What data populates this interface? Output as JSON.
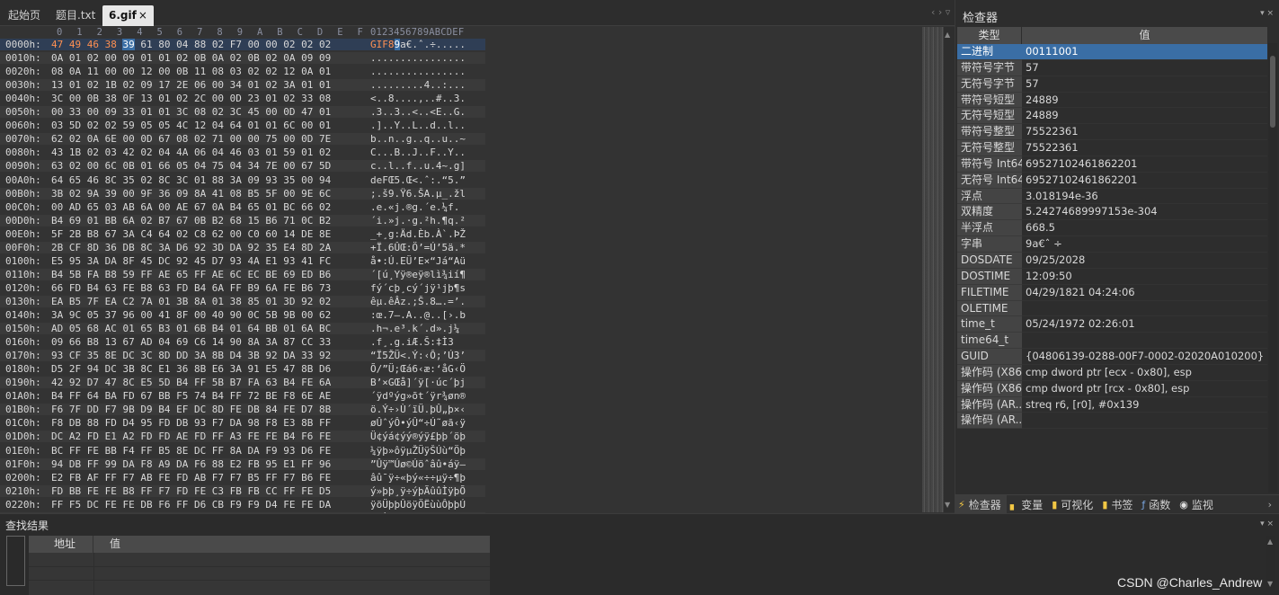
{
  "tabs": [
    {
      "label": "起始页",
      "active": false
    },
    {
      "label": "题目.txt",
      "active": false
    },
    {
      "label": "6.gif",
      "active": true,
      "close": "×"
    }
  ],
  "tab_nav": "‹ › ▿",
  "hex": {
    "column_headers": [
      "0",
      "1",
      "2",
      "3",
      "4",
      "5",
      "6",
      "7",
      "8",
      "9",
      "A",
      "B",
      "C",
      "D",
      "E",
      "F"
    ],
    "ascii_header": "0123456789ABCDEF",
    "rows": [
      {
        "off": "0000h:",
        "hex": "47 49 46 38 39 61 80 04 88 02 F7 00 00 02 02 02",
        "asc": "GIF89a€.ˆ.÷....."
      },
      {
        "off": "0010h:",
        "hex": "0A 01 02 00 09 01 01 02 0B 0A 02 0B 02 0A 09 09",
        "asc": "................"
      },
      {
        "off": "0020h:",
        "hex": "08 0A 11 00 00 12 00 0B 11 08 03 02 02 12 0A 01",
        "asc": "................"
      },
      {
        "off": "0030h:",
        "hex": "13 01 02 1B 02 09 17 2E 06 00 34 01 02 3A 01 01",
        "asc": ".........4..:..."
      },
      {
        "off": "0040h:",
        "hex": "3C 00 0B 38 0F 13 01 02 2C 00 0D 23 01 02 33 08",
        "asc": "<..8....,..#..3."
      },
      {
        "off": "0050h:",
        "hex": "00 33 00 09 33 01 01 3C 08 02 3C 45 00 0D 47 01",
        "asc": ".3..3..<..<E..G."
      },
      {
        "off": "0060h:",
        "hex": "03 5D 02 02 59 05 05 4C 12 04 64 01 01 6C 00 01",
        "asc": ".]..Y..L..d..l.."
      },
      {
        "off": "0070h:",
        "hex": "62 02 0A 6E 00 0D 67 08 02 71 00 00 75 00 0D 7E",
        "asc": "b..n..g..q..u..~"
      },
      {
        "off": "0080h:",
        "hex": "43 1B 02 03 42 02 04 4A 06 04 46 03 01 59 01 02",
        "asc": "C...B..J..F..Y.."
      },
      {
        "off": "0090h:",
        "hex": "63 02 00 6C 0B 01 66 05 04 75 04 34 7E 00 67 5D",
        "asc": "c..l..f..u.4~.g]"
      },
      {
        "off": "00A0h:",
        "hex": "64 65 46 8C 35 02 8C 3C 01 88 3A 09 93 35 00 94",
        "asc": "deFŒ5.Œ<.ˆ:.“5.”"
      },
      {
        "off": "00B0h:",
        "hex": "3B 02 9A 39 00 9F 36 09 8A 41 08 B5 5F 00 9E 6C",
        "asc": ";.š9.Ÿ6.ŠA.µ_.žl"
      },
      {
        "off": "00C0h:",
        "hex": "00 AD 65 03 AB 6A 00 AE 67 0A B4 65 01 BC 66 02",
        "asc": ".­e.«j.®g.´e.¼f."
      },
      {
        "off": "00D0h:",
        "hex": "B4 69 01 BB 6A 02 B7 67 0B B2 68 15 B6 71 0C B2",
        "asc": "´i.»j.·g.²h.¶q.²"
      },
      {
        "off": "00E0h:",
        "hex": "5F 2B B8 67 3A C4 64 02 C8 62 00 C0 60 14 DE 8E",
        "asc": "_+¸g:Äd.Èb.À`.ÞŽ"
      },
      {
        "off": "00F0h:",
        "hex": "2B CF 8D 36 DB 8C 3A D6 92 3D DA 92 35 E4 8D 2A",
        "asc": "+Ï.6ÛŒ:Ö’=Ú’5ä.*"
      },
      {
        "off": "0100h:",
        "hex": "E5 95 3A DA 8F 45 DC 92 45 D7 93 4A E1 93 41 FC",
        "asc": "å•:Ú.EÜ’E×“Já“Aü"
      },
      {
        "off": "0110h:",
        "hex": "B4 5B FA B8 59 FF AE 65 FF AE 6C EC BE 69 ED B6",
        "asc": "´[ú¸Yÿ®eÿ®lì¾ií¶"
      },
      {
        "off": "0120h:",
        "hex": "66 FD B4 63 FE B8 63 FD B4 6A FF B9 6A FE B6 73",
        "asc": "fý´cþ¸cý´jÿ¹jþ¶s"
      },
      {
        "off": "0130h:",
        "hex": "EA B5 7F EA C2 7A 01 3B 8A 01 38 85 01 3D 92 02",
        "asc": "êµ.êÂz.;Š.8….=’."
      },
      {
        "off": "0140h:",
        "hex": "3A 9C 05 37 96 00 41 8F 00 40 90 0C 5B 9B 00 62",
        "asc": ":œ.7–.A..@..[›.b"
      },
      {
        "off": "0150h:",
        "hex": "AD 05 68 AC 01 65 B3 01 6B B4 01 64 BB 01 6A BC",
        "asc": "­.h¬.e³.k´.d».j¼"
      },
      {
        "off": "0160h:",
        "hex": "09 66 B8 13 67 AD 04 69 C6 14 90 8A 3A 87 CC 33",
        "asc": ".f¸.g­.iÆ.Š:‡Ì3"
      },
      {
        "off": "0170h:",
        "hex": "93 CF 35 8E DC 3C 8D DD 3A 8B D4 3B 92 DA 33 92",
        "asc": "“Ï5ŽÜ<.Ý:‹Ô;’Ú3’"
      },
      {
        "off": "0180h:",
        "hex": "D5 2F 94 DC 3B 8C E1 36 8B E6 3A 91 E5 47 8B D6",
        "asc": "Õ/”Ü;Œá6‹æ:‘åG‹Ö"
      },
      {
        "off": "0190h:",
        "hex": "42 92 D7 47 8C E5 5D B4 FF 5B B7 FA 63 B4 FE 6A",
        "asc": "B’×GŒå]´ÿ[·úc´þj"
      },
      {
        "off": "01A0h:",
        "hex": "B4 FF 64 BA FD 67 BB F5 74 B4 FF 72 BE F8 6E AE",
        "asc": "´ÿdºýg»õt´ÿr¾øn®"
      },
      {
        "off": "01B0h:",
        "hex": "F6 7F DD F7 9B D9 B4 EF DC 8D FE DB 84 FE D7 8B",
        "asc": "ö.Ý÷›Ù´ïÜ.þÛ„þ×‹"
      },
      {
        "off": "01C0h:",
        "hex": "F8 DB 88 FD D4 95 FD DB 93 F7 DA 98 F8 E3 8B FF",
        "asc": "øÛˆýÔ•ýÛ“÷Ú˜øã‹ÿ"
      },
      {
        "off": "01D0h:",
        "hex": "DC A2 FD E1 A2 FD FD AE FD FF A3 FE FE B4 F6 FE",
        "asc": "Ü¢ýá¢ýý®ýÿ£þþ´öþ"
      },
      {
        "off": "01E0h:",
        "hex": "BC FF FE BB F4 FF B5 8E DC FF 8A DA F9 93 D6 FE",
        "asc": "¼ÿþ»ôÿµŽÜÿŠÚù“Öþ"
      },
      {
        "off": "01F0h:",
        "hex": "94 DB FF 99 DA F8 A9 DA F6 88 E2 FB 95 E1 FF 96",
        "asc": "”Ûÿ™Úø©Úöˆâû•áÿ–"
      },
      {
        "off": "0200h:",
        "hex": "E2 FB AF FF F7 AB FE FD AB F7 F7 B5 FF F7 B6 FE",
        "asc": "âû¯ÿ÷«þý«÷÷µÿ÷¶þ"
      },
      {
        "off": "0210h:",
        "hex": "FD BB FE FE B8 FF F7 FD FE C3 FB FB CC FF FE D5",
        "asc": "ý»þþ¸ÿ÷ýþÃûûÌÿþÕ"
      },
      {
        "off": "0220h:",
        "hex": "FF F5 DC FE FE DB F6 FF D6 CB F9 F9 D4 FE FE DA",
        "asc": "ÿõÜþþÛöÿÖËùùÔþþÚ"
      },
      {
        "off": "0230h:",
        "hex": "FD FD D9 FA FB EF FC EA FE FD E4 FF F7 ED F5 FF",
        "asc": "ýýÙúûïüêþýäÿ÷íõÿ"
      }
    ]
  },
  "inspector": {
    "title": "检查器",
    "pin": "▾ ×",
    "col_type": "类型",
    "col_value": "值",
    "rows": [
      {
        "k": "二进制",
        "v": "00111001",
        "sel": true
      },
      {
        "k": "带符号字节",
        "v": "57"
      },
      {
        "k": "无符号字节",
        "v": "57"
      },
      {
        "k": "带符号短型",
        "v": "24889"
      },
      {
        "k": "无符号短型",
        "v": "24889"
      },
      {
        "k": "带符号整型",
        "v": "75522361"
      },
      {
        "k": "无符号整型",
        "v": "75522361"
      },
      {
        "k": "带符号 Int64",
        "v": "69527102461862201"
      },
      {
        "k": "无符号 Int64",
        "v": "69527102461862201"
      },
      {
        "k": "浮点",
        "v": "3.018194e-36"
      },
      {
        "k": "双精度",
        "v": "5.24274689997153e-304"
      },
      {
        "k": "半浮点",
        "v": "668.5"
      },
      {
        "k": "字串",
        "v": "9a€ˆ ÷"
      },
      {
        "k": "DOSDATE",
        "v": "09/25/2028"
      },
      {
        "k": "DOSTIME",
        "v": "12:09:50"
      },
      {
        "k": "FILETIME",
        "v": "04/29/1821 04:24:06"
      },
      {
        "k": "OLETIME",
        "v": ""
      },
      {
        "k": "time_t",
        "v": "05/24/1972 02:26:01"
      },
      {
        "k": "time64_t",
        "v": ""
      },
      {
        "k": "GUID",
        "v": "{04806139-0288-00F7-0002-02020A010200}"
      },
      {
        "k": "操作码 (X86...",
        "v": "cmp dword ptr [ecx - 0x80], esp"
      },
      {
        "k": "操作码 (X86...",
        "v": "cmp dword ptr [rcx - 0x80], esp"
      },
      {
        "k": "操作码 (AR...",
        "v": "streq r6, [r0], #0x139"
      },
      {
        "k": "操作码 (AR...",
        "v": ""
      }
    ]
  },
  "panel_tabs": [
    {
      "label": "检查器",
      "icon": "⚡",
      "color": "#f2c744",
      "active": true
    },
    {
      "label": "变量",
      "icon": "▖",
      "color": "#f2c744"
    },
    {
      "label": "可视化",
      "icon": "▮",
      "color": "#f2c744"
    },
    {
      "label": "书签",
      "icon": "▮",
      "color": "#f2c744"
    },
    {
      "label": "函数",
      "icon": "ƒ",
      "color": "#7aa6e0"
    },
    {
      "label": "监视",
      "icon": "◉",
      "color": "#e0e0e0"
    }
  ],
  "panel_more": "›",
  "find": {
    "title": "查找结果",
    "pin": "▾ ×",
    "col_addr": "地址",
    "col_val": "值"
  },
  "watermark": "CSDN @Charles_Andrew"
}
